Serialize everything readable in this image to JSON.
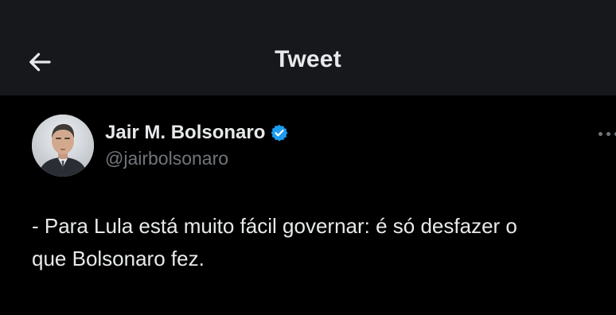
{
  "header": {
    "back_icon": "arrow-left-icon",
    "title": "Tweet"
  },
  "tweet": {
    "author": {
      "display_name": "Jair M. Bolsonaro",
      "handle": "@jairbolsonaro",
      "verified_icon": "verified-badge-icon",
      "avatar_icon": "avatar-photo"
    },
    "more_icon": "more-options-icon",
    "text": "- Para Lula está muito fácil governar: é só desfazer o\nque Bolsonaro fez."
  },
  "colors": {
    "background": "#000000",
    "header_background": "#16181c",
    "primary_text": "#e7e9ea",
    "secondary_text": "#71767b",
    "verified_blue": "#1d9bf0"
  }
}
